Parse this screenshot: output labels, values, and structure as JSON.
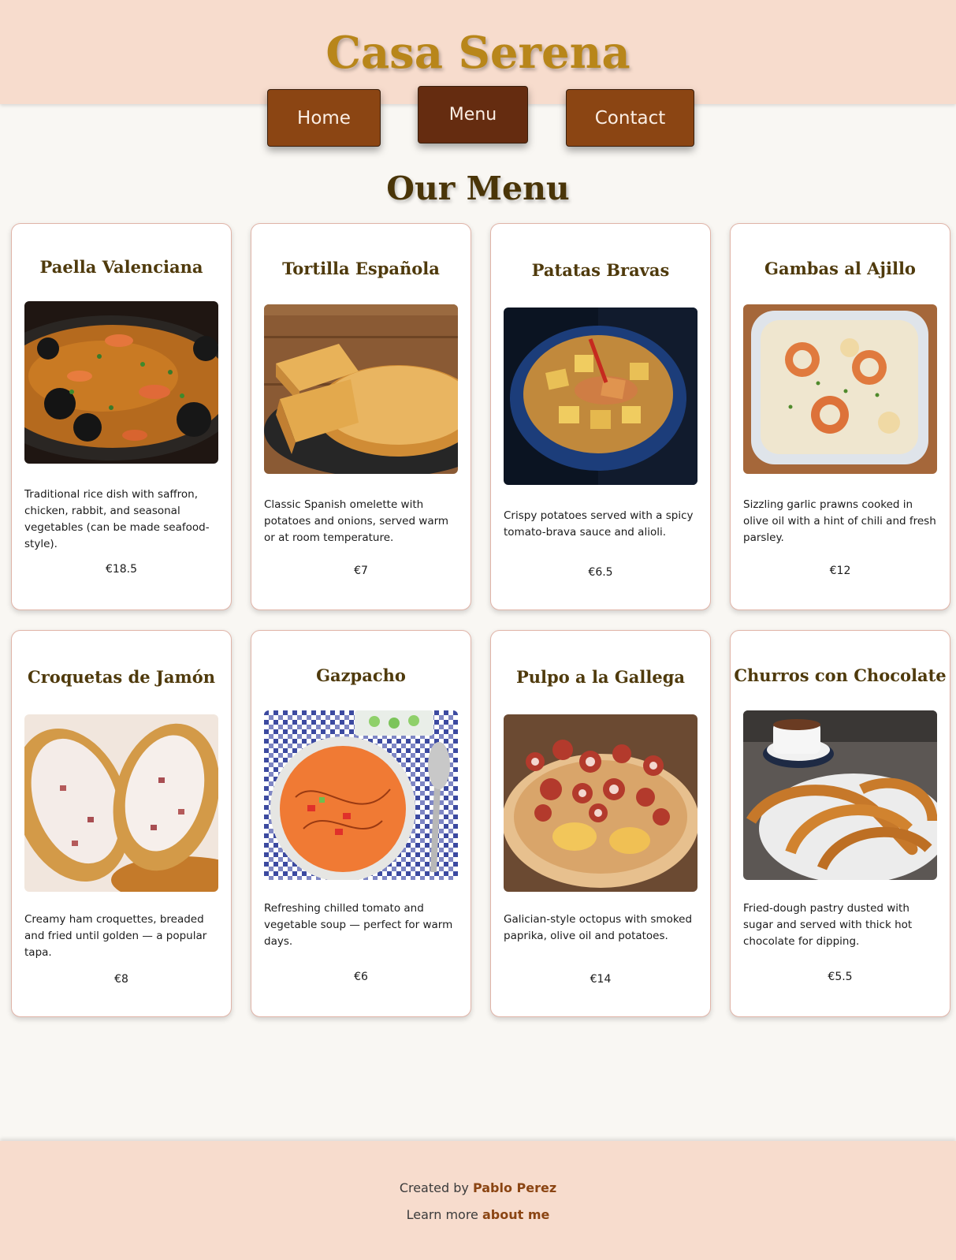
{
  "site": {
    "title": "Casa Serena"
  },
  "nav": [
    {
      "label": "Home"
    },
    {
      "label": "Menu"
    },
    {
      "label": "Contact"
    }
  ],
  "menu": {
    "heading": "Our Menu",
    "items": [
      {
        "name": "Paella Valenciana",
        "description": "Traditional rice dish with saffron, chicken, rabbit, and seasonal vegetables (can be made seafood-style).",
        "price": "€18.5",
        "image": "paella-photo"
      },
      {
        "name": "Tortilla Española",
        "description": "Classic Spanish omelette with potatoes and onions, served warm or at room temperature.",
        "price": "€7",
        "image": "tortilla-photo"
      },
      {
        "name": "Patatas Bravas",
        "description": "Crispy potatoes served with a spicy tomato-brava sauce and alioli.",
        "price": "€6.5",
        "image": "patatas-bravas-photo"
      },
      {
        "name": "Gambas al Ajillo",
        "description": "Sizzling garlic prawns cooked in olive oil with a hint of chili and fresh parsley.",
        "price": "€12",
        "image": "gambas-photo"
      },
      {
        "name": "Croquetas de Jamón",
        "description": "Creamy ham croquettes, breaded and fried until golden — a popular tapa.",
        "price": "€8",
        "image": "croquetas-photo"
      },
      {
        "name": "Gazpacho",
        "description": "Refreshing chilled tomato and vegetable soup — perfect for warm days.",
        "price": "€6",
        "image": "gazpacho-photo"
      },
      {
        "name": "Pulpo a la Gallega",
        "description": "Galician-style octopus with smoked paprika, olive oil and potatoes.",
        "price": "€14",
        "image": "pulpo-photo"
      },
      {
        "name": "Churros con Chocolate",
        "description": "Fried-dough pastry dusted with sugar and served with thick hot chocolate for dipping.",
        "price": "€5.5",
        "image": "churros-photo"
      }
    ]
  },
  "footer": {
    "created_prefix": "Created by",
    "author": "Pablo Perez",
    "learn_prefix": "Learn more",
    "about_link": "about me"
  },
  "colors": {
    "header_bg": "#f7dccd",
    "brand": "#b8861a",
    "nav_button": "#8b4513",
    "nav_button_active": "#652c10",
    "heading": "#4a3508",
    "link": "#8b4513"
  }
}
